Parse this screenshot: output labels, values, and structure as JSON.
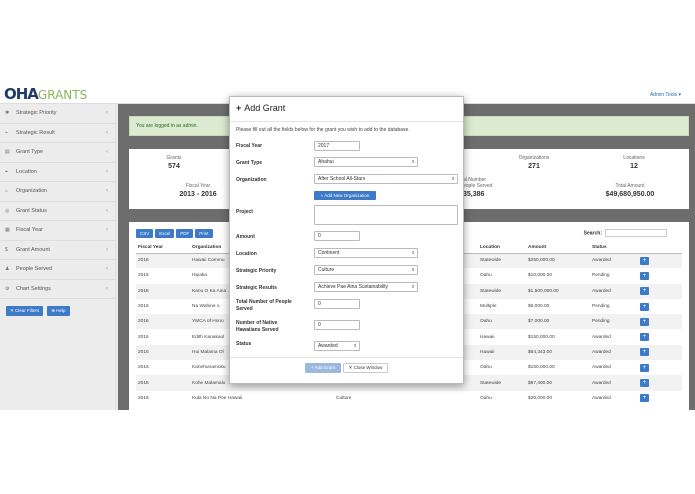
{
  "header": {
    "logo_main": "OHA",
    "logo_sub": "GRANTS",
    "admin_label": "Admin Tools ▾"
  },
  "sidebar": {
    "items": [
      {
        "icon": "✱",
        "label": "Strategic Priority"
      },
      {
        "icon": "⌁",
        "label": "Strategic Result"
      },
      {
        "icon": "▤",
        "label": "Grant Type"
      },
      {
        "icon": "⌖",
        "label": "Location"
      },
      {
        "icon": "⌂",
        "label": "Organization"
      },
      {
        "icon": "◎",
        "label": "Grant Status"
      },
      {
        "icon": "▦",
        "label": "Fiscal Year"
      },
      {
        "icon": "$",
        "label": "Grant Amount"
      },
      {
        "icon": "♟",
        "label": "People Served"
      },
      {
        "icon": "⚙",
        "label": "Chart Settings"
      }
    ],
    "clear_filters": "✕ Clear Filters",
    "help": "⊕ Help"
  },
  "alert": {
    "prefix": "You are logged in as ",
    "user": "admin",
    "suffix": "."
  },
  "stats": {
    "grants_label": "Grants",
    "grants_value": "574",
    "orgs_label": "Organizations",
    "orgs_value": "271",
    "locations_label": "Locations",
    "locations_value": "12",
    "fy_label": "Fiscal Year",
    "fy_value": "2013 - 2016",
    "served_label_1": "al Number",
    "served_label_2": "eople Served",
    "served_value": "35,386",
    "total_label": "Total Amount",
    "total_value": "$49,680,950.00"
  },
  "export_buttons": [
    "CSV",
    "Excel",
    "PDF",
    "Print"
  ],
  "search_label": "Search:",
  "table": {
    "headers": [
      "Fiscal Year",
      "Organization",
      "",
      "Location",
      "Amount",
      "Status"
    ],
    "rows": [
      [
        "2016",
        "Hawaii Commu",
        "",
        "Statewide",
        "$250,000.00",
        "Awarded"
      ],
      [
        "2016",
        "Hipaka",
        "",
        "Oahu",
        "$10,000.00",
        "Pending"
      ],
      [
        "2016",
        "Kanu O Ka Aina",
        "",
        "Statewide",
        "$1,500,000.00",
        "Awarded"
      ],
      [
        "2016",
        "Na Wahine o",
        "",
        "Multiple",
        "$6,000.00",
        "Pending"
      ],
      [
        "2016",
        "YMCA of Hono",
        "",
        "Oahu",
        "$7,000.00",
        "Pending"
      ],
      [
        "2016",
        "Edith Kanakaol",
        "",
        "Hawaii",
        "$150,000.00",
        "Awarded"
      ],
      [
        "2016",
        "Hui Malama Ol",
        "",
        "Hawaii",
        "$64,343.00",
        "Awarded"
      ],
      [
        "2016",
        "Kanehunamoku",
        "",
        "Oahu",
        "$150,000.00",
        "Awarded"
      ],
      [
        "2016",
        "Kohe Malamalo",
        "",
        "Statewide",
        "$67,400.00",
        "Awarded"
      ],
      [
        "2016",
        "Kula No Na Poe Hawaii",
        "Culture",
        "Oahu",
        "$20,000.00",
        "Awarded"
      ]
    ]
  },
  "modal": {
    "title": "Add Grant",
    "intro": "Please fill out all the fields below for the grant you wish to add to the database.",
    "fields": {
      "fiscal_year_label": "Fiscal Year",
      "fiscal_year_value": "2017",
      "grant_type_label": "Grant Type",
      "grant_type_value": "Ahahui",
      "organization_label": "Organization",
      "organization_value": "After School All-Stars",
      "add_org": "+ Add New Organization",
      "project_label": "Project",
      "amount_label": "Amount",
      "amount_value": "0",
      "location_label": "Location",
      "location_value": "Continent",
      "priority_label": "Strategic Priority",
      "priority_value": "Culture",
      "results_label": "Strategic Results",
      "results_value": "Achieve Pae Aina Sustainability",
      "total_people_label_1": "Total Number of People",
      "total_people_label_2": "Served",
      "total_people_value": "0",
      "native_label_1": "Number of Native",
      "native_label_2": "Hawaiians Served",
      "native_value": "0",
      "status_label": "Status",
      "status_value": "Awarded"
    },
    "add_button": "+ Add Grant",
    "close_button": "✕ Close Window"
  }
}
